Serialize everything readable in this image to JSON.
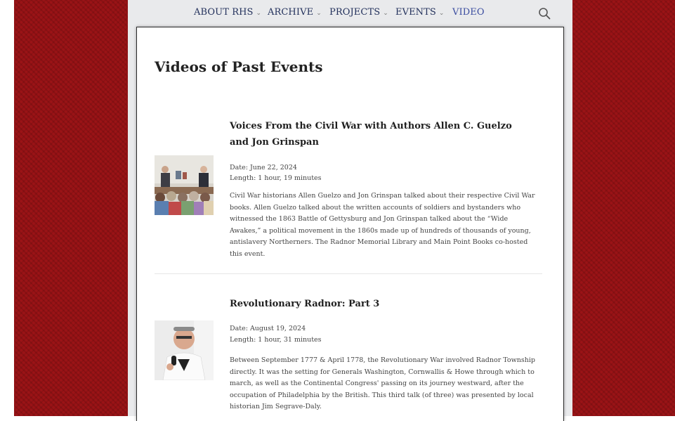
{
  "nav": {
    "items": [
      {
        "label": "ABOUT RHS",
        "chevron": "⌄"
      },
      {
        "label": "ARCHIVE",
        "chevron": "⌄"
      },
      {
        "label": "PROJECTS",
        "chevron": "⌄"
      },
      {
        "label": "EVENTS",
        "chevron": "⌄"
      },
      {
        "label": "VIDEO"
      }
    ],
    "search_icon": "search-icon"
  },
  "page": {
    "title": "Videos of Past Events"
  },
  "videos": [
    {
      "title": "Voices From the Civil War with Authors Allen C. Guelzo and Jon Grinspan",
      "date": "Date: June 22, 2024",
      "length": "Length: 1 hour, 19 minutes",
      "description": "Civil War historians Allen Guelzo and Jon Grinspan talked about their respective Civil War books. Allen Guelzo talked about the written accounts of soldiers and bystanders who witnessed the 1863 Battle of Gettysburg and Jon Grinspan talked about the “Wide Awakes,” a political movement in the 1860s made up of hundreds of thousands of young, antislavery Northerners. The Radnor Memorial Library and Main Point Books co-hosted this event."
    },
    {
      "title": "Revolutionary Radnor: Part 3",
      "date": "Date: August 19, 2024",
      "length": "Length: 1 hour, 31 minutes",
      "description": "Between September 1777 & April 1778, the Revolutionary War involved Radnor Township directly. It was the setting for Generals Washington, Cornwallis & Howe through which to march, as well as the Continental Congress' passing on its journey westward, after the occupation of Philadelphia by the British. This third talk (of three) was presented by local historian Jim Segrave-Daly."
    }
  ],
  "colors": {
    "background_red": "#9b1316",
    "nav_text": "#23315c",
    "nav_active": "#3b4da0"
  }
}
